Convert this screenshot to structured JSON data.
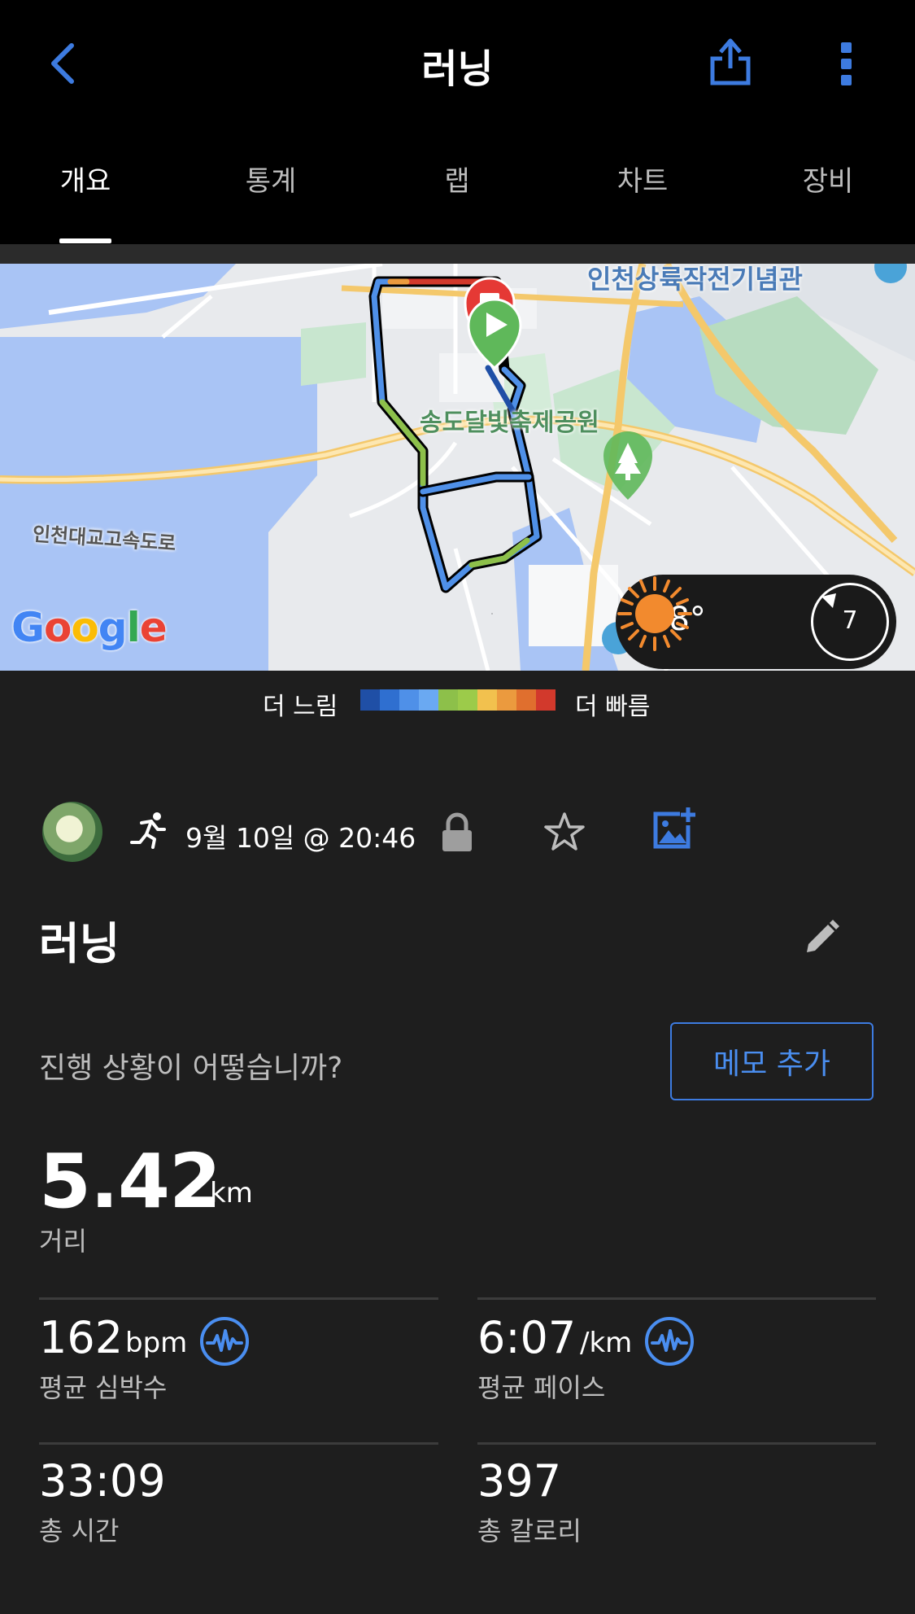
{
  "header": {
    "title": "러닝",
    "tabs": [
      {
        "label": "개요",
        "active": true
      },
      {
        "label": "통계",
        "active": false
      },
      {
        "label": "랩",
        "active": false
      },
      {
        "label": "차트",
        "active": false
      },
      {
        "label": "장비",
        "active": false
      }
    ]
  },
  "map": {
    "labels": {
      "landmark_top": "인천상륙작전기념관",
      "park": "송도달빛축제공원",
      "highway": "인천대교고속도로"
    },
    "logo": "Google",
    "weather": {
      "temperature": "28°",
      "icon": "sun-icon",
      "wind": "7"
    }
  },
  "legend": {
    "slower": "더 느림",
    "faster": "더 빠름",
    "colors": [
      "#1f4fa6",
      "#2f6fd0",
      "#4f90e8",
      "#6aa9f2",
      "#8dc04a",
      "#9ccb4a",
      "#f2c14e",
      "#eb9a3e",
      "#e06f2e",
      "#d2392c"
    ]
  },
  "activity": {
    "date": "9월 10일 @ 20:46",
    "title": "러닝",
    "prompt": "진행 상황이 어떻습니까?",
    "memo_button": "메모 추가"
  },
  "stats": {
    "distance": {
      "value": "5.42",
      "unit": "km",
      "label": "거리"
    },
    "heart_rate": {
      "value": "162",
      "unit": "bpm",
      "label": "평균 심박수"
    },
    "pace": {
      "value": "6:07",
      "unit": "/km",
      "label": "평균 페이스"
    },
    "time": {
      "value": "33:09",
      "label": "총 시간"
    },
    "calories": {
      "value": "397",
      "label": "총 칼로리"
    }
  },
  "colors": {
    "accent": "#3d7be0",
    "background": "#1e1e1e",
    "header": "#000000"
  }
}
